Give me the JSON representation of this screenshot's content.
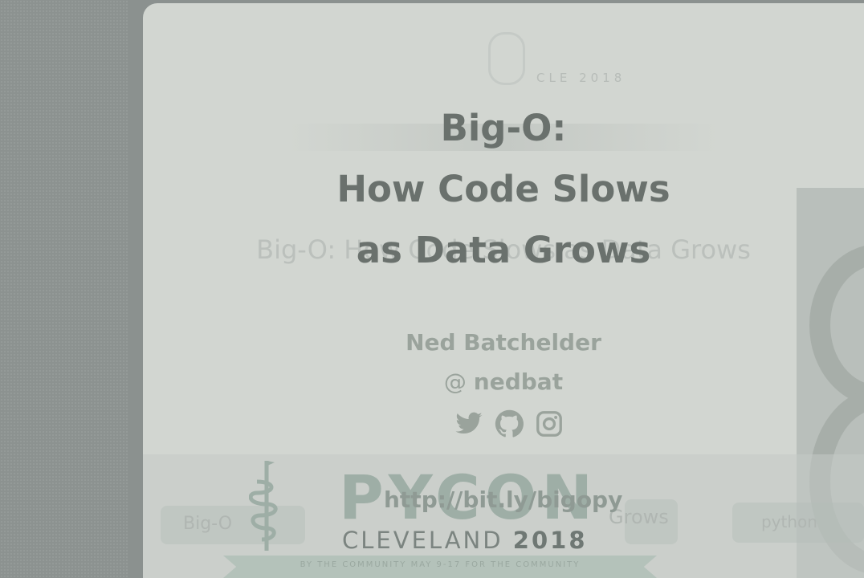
{
  "slide": {
    "title_lines": [
      "Big-O:",
      "How Code Slows",
      "as Data Grows"
    ],
    "ghost_title": "Big-O: How Code Slows as Data Grows",
    "ghost_year": "CLE 2018",
    "author": "Ned Batchelder",
    "handle_at": "@",
    "handle_name": "nedbat",
    "social_icons": [
      "twitter-icon",
      "github-icon",
      "instagram-icon"
    ],
    "link": "http://bit.ly/bigopy"
  },
  "conference": {
    "name": "PYCON",
    "city": "CLEVELAND",
    "year": "2018",
    "ribbon": "BY THE COMMUNITY       MAY 9-17       FOR THE COMMUNITY"
  },
  "ghost_boxes": {
    "left": "Big-O",
    "middle": "Grows",
    "right": "python"
  },
  "colors": {
    "background": "#8b918f",
    "slide": "#d2d6d1",
    "title": "#6a716d",
    "author": "#9aa39c"
  }
}
